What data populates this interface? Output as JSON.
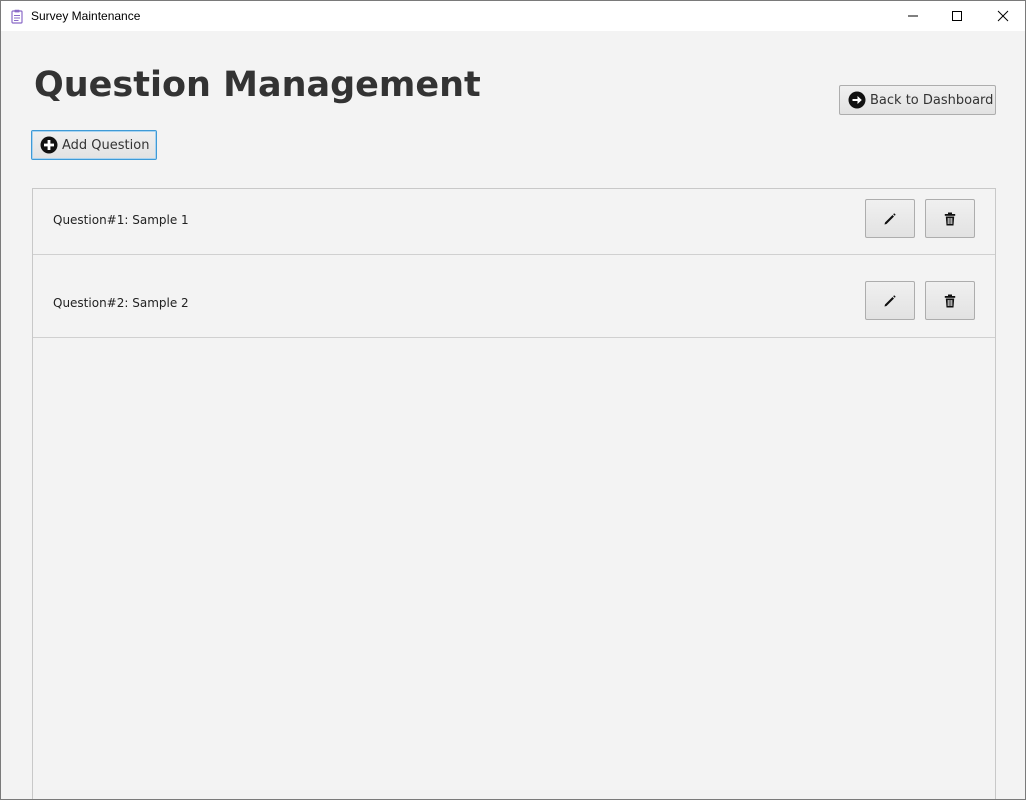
{
  "window": {
    "title": "Survey Maintenance",
    "icon": "clipboard-icon",
    "controls": [
      "minimize-icon",
      "maximize-icon",
      "close-icon"
    ]
  },
  "header": {
    "title": "Question Management",
    "back_button_label": "Back to Dashboard",
    "back_button_icon": "arrow-circle-right-icon"
  },
  "toolbar": {
    "add_button_label": "Add Question",
    "add_button_icon": "plus-circle-icon"
  },
  "questions": [
    {
      "label": "Question#1: Sample 1",
      "edit_icon": "pencil-icon",
      "delete_icon": "trash-icon"
    },
    {
      "label": "Question#2: Sample 2",
      "edit_icon": "pencil-icon",
      "delete_icon": "trash-icon"
    }
  ],
  "colors": {
    "background": "#f3f3f3",
    "title_text": "#333333",
    "focus_border": "#3e9ad6",
    "app_icon": "#8b6bc7"
  }
}
